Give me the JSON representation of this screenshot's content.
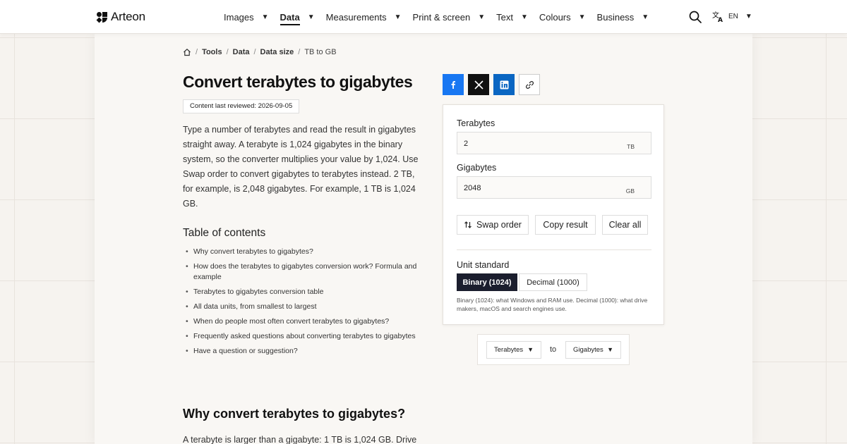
{
  "brand": {
    "name": "Arteon"
  },
  "nav": {
    "items": [
      {
        "label": "Images"
      },
      {
        "label": "Data"
      },
      {
        "label": "Measurements"
      },
      {
        "label": "Print & screen"
      },
      {
        "label": "Text"
      },
      {
        "label": "Colours"
      },
      {
        "label": "Business"
      }
    ],
    "language": "EN"
  },
  "breadcrumb": {
    "items": [
      "Tools",
      "Data",
      "Data size"
    ],
    "current": "TB to GB"
  },
  "page": {
    "title": "Convert terabytes to gigabytes",
    "reviewed": "Content last reviewed: 2026-09-05",
    "intro": "Type a number of terabytes and read the result in gigabytes straight away. A terabyte is 1,024 gigabytes in the binary system, so the converter multiplies your value by 1,024. Use Swap order to convert gigabytes to terabytes instead. 2 TB, for example, is 2,048 gigabytes. For example, 1 TB is 1,024 GB."
  },
  "toc": {
    "title": "Table of contents",
    "items": [
      "Why convert terabytes to gigabytes?",
      "How does the terabytes to gigabytes conversion work? Formula and example",
      "Terabytes to gigabytes conversion table",
      "All data units, from smallest to largest",
      "When do people most often convert terabytes to gigabytes?",
      "Frequently asked questions about converting terabytes to gigabytes",
      "Have a question or suggestion?"
    ]
  },
  "section": {
    "title": "Why convert terabytes to gigabytes?",
    "text": "A terabyte is larger than a gigabyte: 1 TB is 1,024 GB. Drive"
  },
  "converter": {
    "from_label": "Terabytes",
    "from_value": "2",
    "from_unit": "TB",
    "to_label": "Gigabytes",
    "to_value": "2048",
    "to_unit": "GB",
    "swap_label": "Swap order",
    "copy_label": "Copy result",
    "clear_label": "Clear all",
    "standard_label": "Unit standard",
    "binary_label": "Binary (1024)",
    "decimal_label": "Decimal (1000)",
    "standard_note": "Binary (1024): what Windows and RAM use. Decimal (1000): what drive makers, macOS and search engines use.",
    "selected_standard": "Binary (1024)"
  },
  "switcher": {
    "from": "Terabytes",
    "to_word": "to",
    "to": "Gigabytes"
  },
  "colors": {
    "facebook": "#1877f2",
    "x": "#111111",
    "linkedin": "#0a66c2",
    "active_segment": "#1b1e2e"
  }
}
